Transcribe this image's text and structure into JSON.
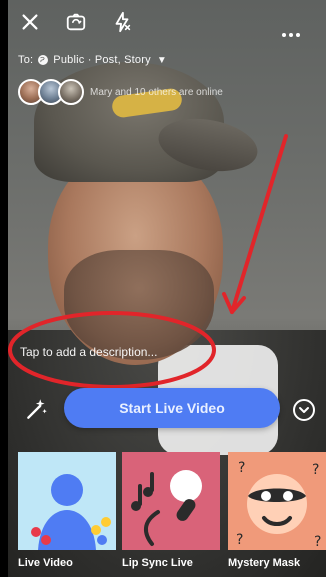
{
  "audience": {
    "prefix": "To:",
    "value": "Public · Post, Story"
  },
  "viewers": {
    "online_text": "Mary and 10 others are online"
  },
  "composer": {
    "description_placeholder": "Tap to add a description..."
  },
  "actions": {
    "start_label": "Start Live Video"
  },
  "modes": [
    {
      "label": "Live Video"
    },
    {
      "label": "Lip Sync Live"
    },
    {
      "label": "Mystery Mask"
    }
  ],
  "colors": {
    "primary_button": "#4F7CF3",
    "annotation_red": "#E1252A"
  }
}
